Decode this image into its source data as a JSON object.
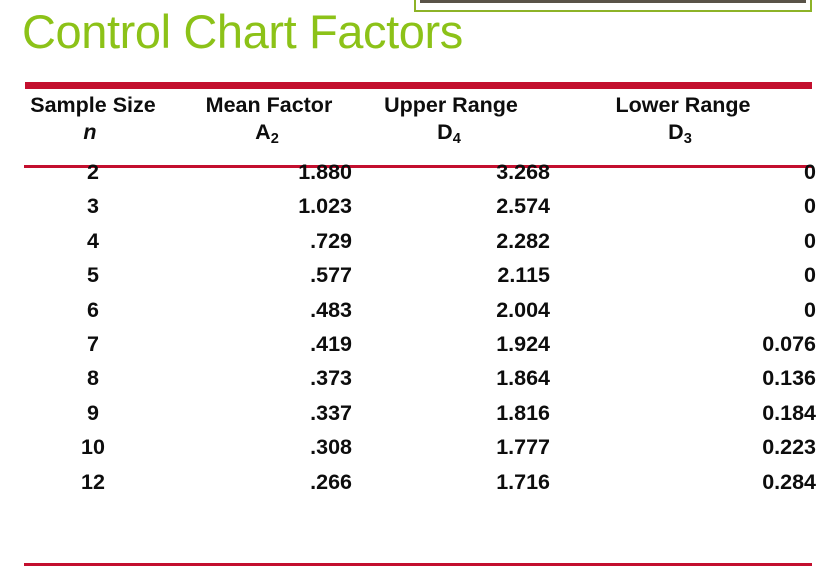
{
  "slide": {
    "title": "Control Chart Factors",
    "title_color": "#8CC218",
    "rule_color": "#C30F2E",
    "top_box_border_color": "#8DB327",
    "top_box_bar_color": "#595348"
  },
  "table": {
    "headers": [
      {
        "line1": "Sample Size",
        "line2": "n",
        "sub": "",
        "italic": true
      },
      {
        "line1": "Mean Factor",
        "line2": "A",
        "sub": "2",
        "italic": false
      },
      {
        "line1": "Upper Range",
        "line2": "D",
        "sub": "4",
        "italic": false
      },
      {
        "line1": "Lower Range",
        "line2": "D",
        "sub": "3",
        "italic": false
      }
    ],
    "rows": [
      {
        "n": "2",
        "a2": "1.880",
        "d4": "3.268",
        "d3": "0"
      },
      {
        "n": "3",
        "a2": "1.023",
        "d4": "2.574",
        "d3": "0"
      },
      {
        "n": "4",
        "a2": ".729",
        "d4": "2.282",
        "d3": "0"
      },
      {
        "n": "5",
        "a2": ".577",
        "d4": "2.115",
        "d3": "0"
      },
      {
        "n": "6",
        "a2": ".483",
        "d4": "2.004",
        "d3": "0"
      },
      {
        "n": "7",
        "a2": ".419",
        "d4": "1.924",
        "d3": "0.076"
      },
      {
        "n": "8",
        "a2": ".373",
        "d4": "1.864",
        "d3": "0.136"
      },
      {
        "n": "9",
        "a2": ".337",
        "d4": "1.816",
        "d3": "0.184"
      },
      {
        "n": "10",
        "a2": ".308",
        "d4": "1.777",
        "d3": "0.223"
      },
      {
        "n": "12",
        "a2": ".266",
        "d4": "1.716",
        "d3": "0.284"
      }
    ]
  },
  "chart_data": {
    "type": "table",
    "title": "Control Chart Factors",
    "columns": [
      "Sample Size n",
      "Mean Factor A2",
      "Upper Range D4",
      "Lower Range D3"
    ],
    "rows": [
      [
        2,
        1.88,
        3.268,
        0
      ],
      [
        3,
        1.023,
        2.574,
        0
      ],
      [
        4,
        0.729,
        2.282,
        0
      ],
      [
        5,
        0.577,
        2.115,
        0
      ],
      [
        6,
        0.483,
        2.004,
        0
      ],
      [
        7,
        0.419,
        1.924,
        0.076
      ],
      [
        8,
        0.373,
        1.864,
        0.136
      ],
      [
        9,
        0.337,
        1.816,
        0.184
      ],
      [
        10,
        0.308,
        1.777,
        0.223
      ],
      [
        12,
        0.266,
        1.716,
        0.284
      ]
    ]
  }
}
